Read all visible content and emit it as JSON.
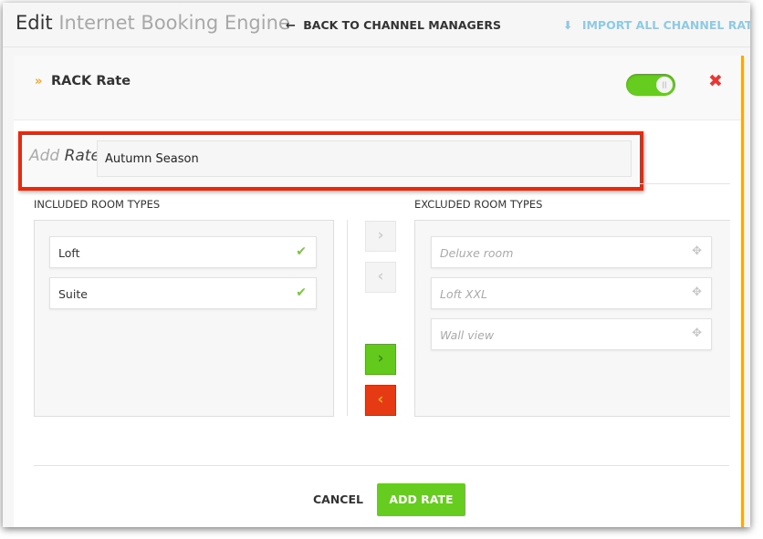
{
  "header": {
    "title_prefix": "Edit",
    "title_name": "Internet Booking Engine",
    "back_arrow": "←",
    "back_label": "BACK TO CHANNEL MANAGERS",
    "import_arrow": "⬇",
    "import_label": "IMPORT ALL CHANNEL RATES"
  },
  "rate_card": {
    "collapse_icon": "»",
    "title": "RACK Rate",
    "toggle_on": true,
    "close_icon": "✖"
  },
  "add_rate": {
    "label_prefix": "Add",
    "label_main": "Rate",
    "value": "Autumn Season"
  },
  "included": {
    "heading": "INCLUDED ROOM TYPES",
    "items": [
      {
        "label": "Loft",
        "icon": "✔"
      },
      {
        "label": "Suite",
        "icon": "✔"
      }
    ]
  },
  "excluded": {
    "heading": "EXCLUDED ROOM TYPES",
    "items": [
      {
        "label": "Deluxe room",
        "icon": "✥"
      },
      {
        "label": "Loft XXL",
        "icon": "✥"
      },
      {
        "label": "Wall view",
        "icon": "✥"
      }
    ]
  },
  "transfer": {
    "move_right": "›",
    "move_left": "‹",
    "move_all_right": "›",
    "move_all_left": "‹"
  },
  "footer": {
    "cancel_label": "CANCEL",
    "add_label": "ADD RATE"
  },
  "colors": {
    "accent_green": "#66cc1f",
    "danger_red": "#e53935",
    "highlight_border": "#e32b12",
    "gold_rail": "#f5a623",
    "link_blue": "#8ccbe6"
  }
}
